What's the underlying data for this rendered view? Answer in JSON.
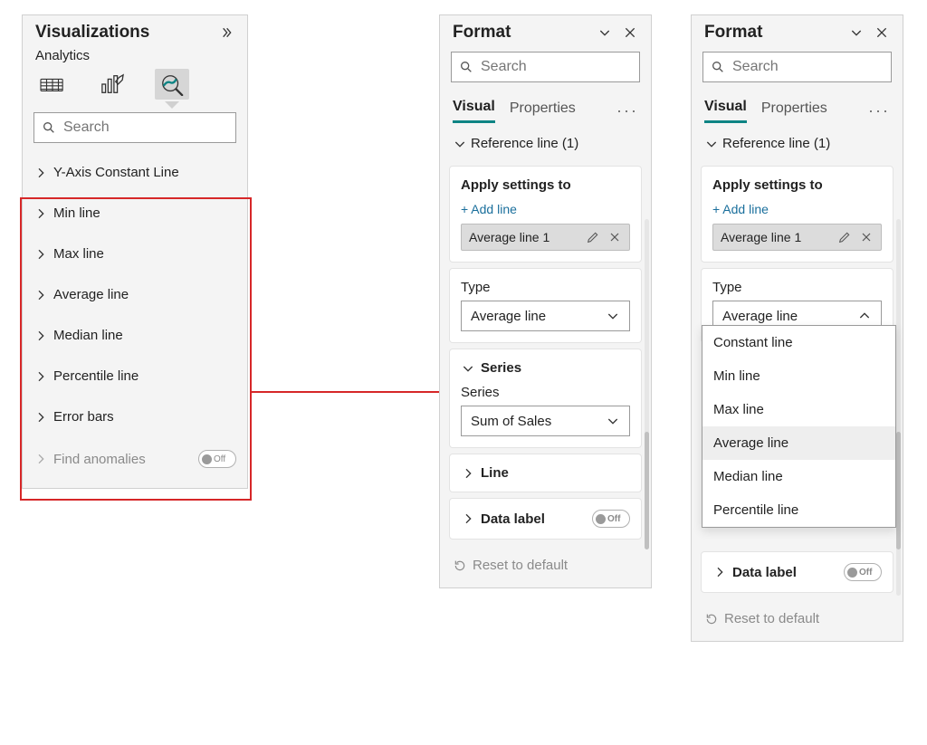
{
  "viz": {
    "title": "Visualizations",
    "subtitle": "Analytics",
    "search_placeholder": "Search",
    "items": [
      {
        "label": "Y-Axis Constant Line"
      },
      {
        "label": "Min line"
      },
      {
        "label": "Max line"
      },
      {
        "label": "Average line"
      },
      {
        "label": "Median line"
      },
      {
        "label": "Percentile line"
      },
      {
        "label": "Error bars"
      }
    ],
    "anomalies_label": "Find anomalies",
    "toggle_off": "Off"
  },
  "format1": {
    "title": "Format",
    "search_placeholder": "Search",
    "tab_visual": "Visual",
    "tab_properties": "Properties",
    "section_ref": "Reference line (1)",
    "apply_title": "Apply settings to",
    "add_line": "+ Add line",
    "selected_line": "Average line 1",
    "type_label": "Type",
    "type_value": "Average line",
    "series_header": "Series",
    "series_label": "Series",
    "series_value": "Sum of Sales",
    "line_header": "Line",
    "data_label_header": "Data label",
    "reset": "Reset to default",
    "toggle_off": "Off"
  },
  "format2": {
    "title": "Format",
    "search_placeholder": "Search",
    "tab_visual": "Visual",
    "tab_properties": "Properties",
    "section_ref": "Reference line (1)",
    "apply_title": "Apply settings to",
    "add_line": "+ Add line",
    "selected_line": "Average line 1",
    "type_label": "Type",
    "type_value": "Average line",
    "type_options": [
      "Constant line",
      "Min line",
      "Max line",
      "Average line",
      "Median line",
      "Percentile line"
    ],
    "data_label_header": "Data label",
    "reset": "Reset to default",
    "toggle_off": "Off"
  }
}
